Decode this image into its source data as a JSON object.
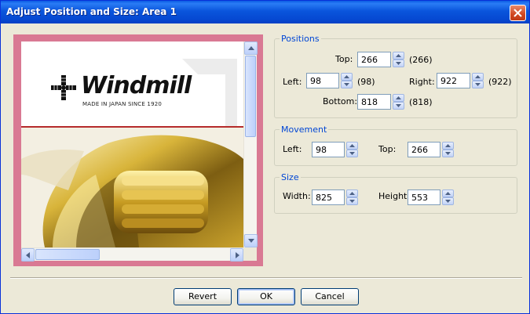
{
  "window": {
    "title": "Adjust Position and Size: Area 1",
    "close_icon": "close-icon"
  },
  "preview": {
    "logo_brand": "Windmill",
    "logo_tagline": "MADE IN JAPAN SINCE 1920",
    "frame_color": "#d97993"
  },
  "positions": {
    "group_title": "Positions",
    "top_label": "Top:",
    "top_value": "266",
    "top_original": "(266)",
    "left_label": "Left:",
    "left_value": "98",
    "left_original": "(98)",
    "right_label": "Right:",
    "right_value": "922",
    "right_original": "(922)",
    "bottom_label": "Bottom:",
    "bottom_value": "818",
    "bottom_original": "(818)"
  },
  "movement": {
    "group_title": "Movement",
    "left_label": "Left:",
    "left_value": "98",
    "top_label": "Top:",
    "top_value": "266"
  },
  "size": {
    "group_title": "Size",
    "width_label": "Width:",
    "width_value": "825",
    "height_label": "Height",
    "height_value": "553"
  },
  "buttons": {
    "revert": "Revert",
    "ok": "OK",
    "cancel": "Cancel"
  },
  "colors": {
    "titlebar": "#0a55dc",
    "group_title": "#0046d5",
    "dialog_bg": "#ece9d8"
  }
}
